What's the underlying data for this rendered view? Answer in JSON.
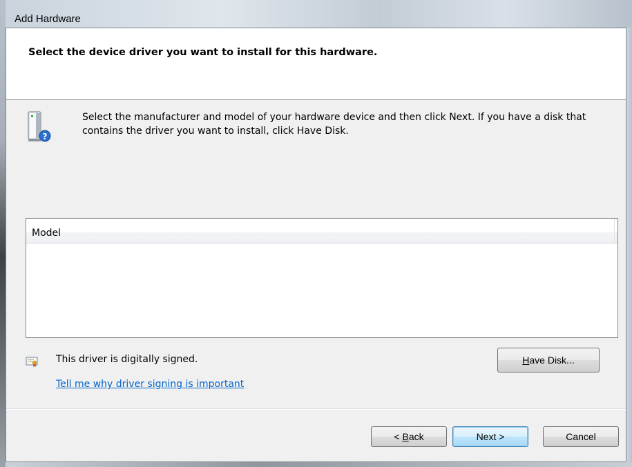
{
  "window": {
    "title": "Add Hardware"
  },
  "header": {
    "title": "Select the device driver you want to install for this hardware."
  },
  "instruction": {
    "text": "Select the manufacturer and model of your hardware device and then click Next. If you have a disk that contains the driver you want to install, click Have Disk."
  },
  "model_list": {
    "column_header": "Model",
    "rows": []
  },
  "signing": {
    "status_text": "This driver is digitally signed.",
    "link_text": "Tell me why driver signing is important"
  },
  "buttons": {
    "have_disk_prefix": "",
    "have_disk_accel": "H",
    "have_disk_rest": "ave Disk...",
    "back_prefix": "< ",
    "back_accel": "B",
    "back_rest": "ack",
    "next": "Next >",
    "cancel": "Cancel"
  },
  "icons": {
    "hardware": "hardware-help-icon",
    "certificate": "certificate-icon"
  },
  "colors": {
    "link": "#0066cc",
    "default_button_border": "#3c7fb1",
    "dialog_background": "#f0f0f0"
  }
}
